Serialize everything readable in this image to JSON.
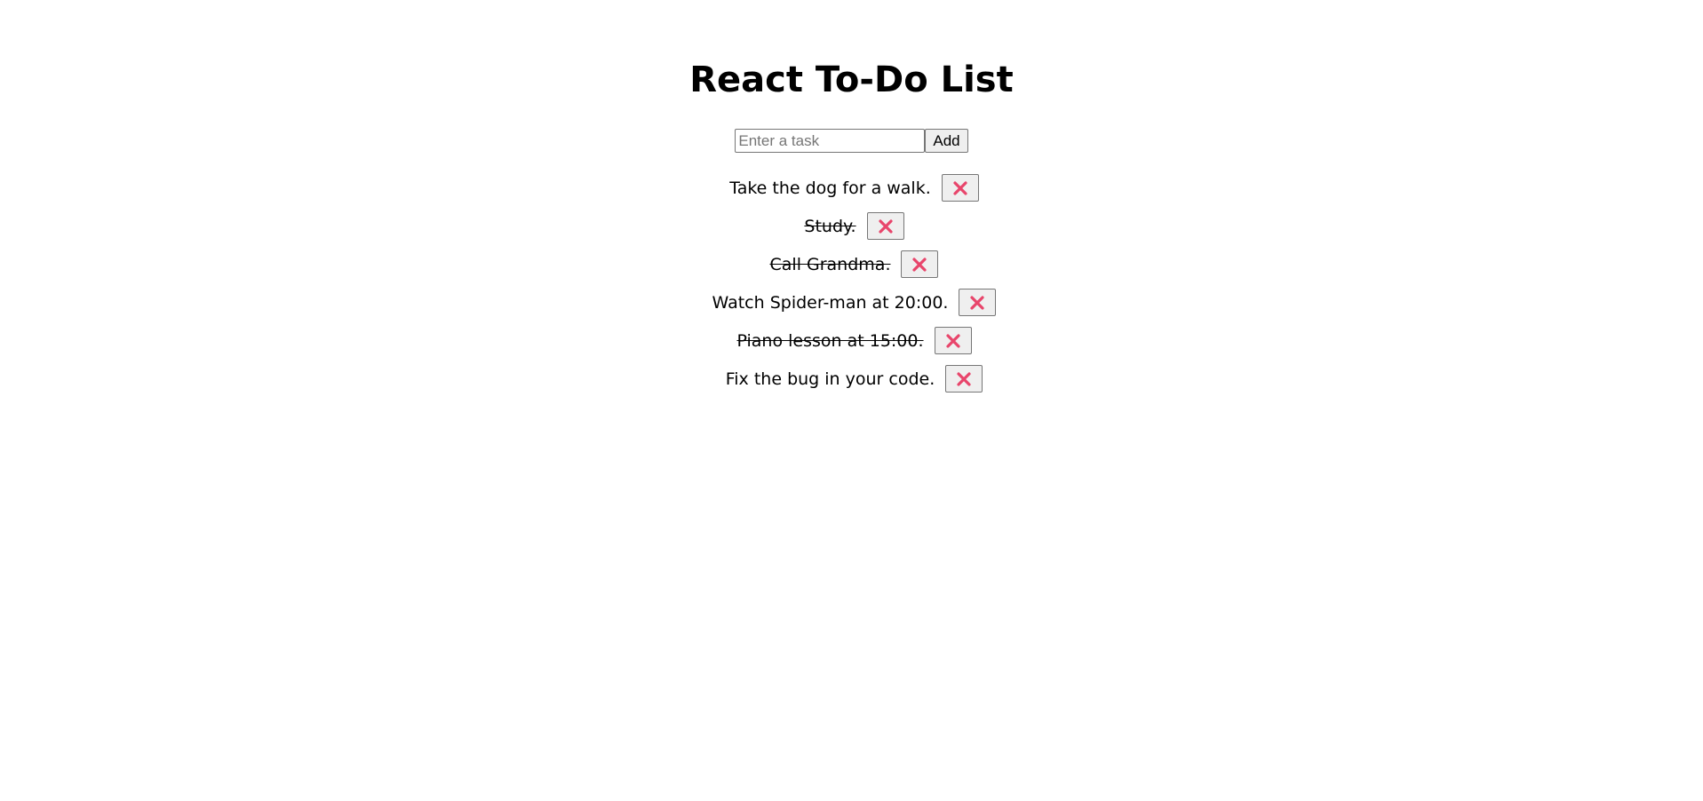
{
  "header": {
    "title": "React To-Do List"
  },
  "add_form": {
    "placeholder": "Enter a task",
    "value": "",
    "add_label": "Add"
  },
  "accent_colors": {
    "delete_icon": "#e8456b"
  },
  "todos": [
    {
      "text": "Take the dog for a walk.",
      "completed": false,
      "delete_icon": "close-icon"
    },
    {
      "text": "Study.",
      "completed": true,
      "delete_icon": "close-icon"
    },
    {
      "text": "Call Grandma.",
      "completed": true,
      "delete_icon": "close-icon"
    },
    {
      "text": "Watch Spider-man at 20:00.",
      "completed": false,
      "delete_icon": "close-icon"
    },
    {
      "text": "Piano lesson at 15:00.",
      "completed": true,
      "delete_icon": "close-icon"
    },
    {
      "text": "Fix the bug in your code.",
      "completed": false,
      "delete_icon": "close-icon"
    }
  ]
}
